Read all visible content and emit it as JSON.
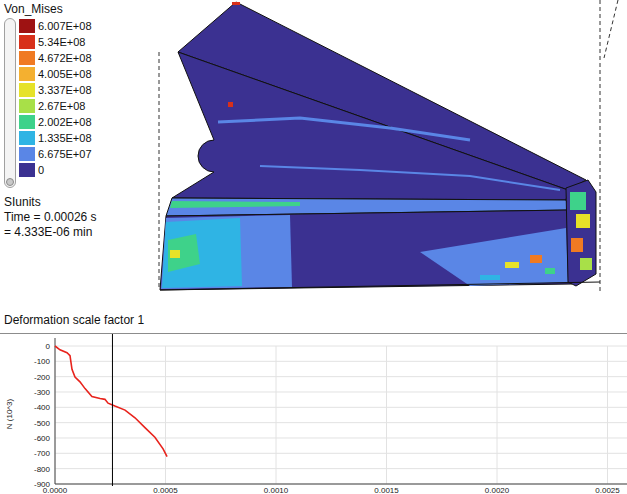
{
  "legend": {
    "title": "Von_Mises",
    "slider": {
      "level": 0
    },
    "levels": [
      {
        "value": "6.007E+08",
        "color": "#9e1212"
      },
      {
        "value": "5.34E+08",
        "color": "#d8301a"
      },
      {
        "value": "4.672E+08",
        "color": "#f07a22"
      },
      {
        "value": "4.005E+08",
        "color": "#f4b030"
      },
      {
        "value": "3.337E+08",
        "color": "#e6e228"
      },
      {
        "value": "2.67E+08",
        "color": "#a8e048"
      },
      {
        "value": "2.002E+08",
        "color": "#3ed28a"
      },
      {
        "value": "1.335E+08",
        "color": "#2fb4e4"
      },
      {
        "value": "6.675E+07",
        "color": "#5a86e6"
      },
      {
        "value": "0",
        "color": "#3b3191"
      }
    ]
  },
  "units": "SIunits",
  "time_lines": [
    "Time = 0.00026 s",
    "= 4.333E-06 min"
  ],
  "deformation": "Deformation scale factor 1",
  "chart": {
    "y_label": "N (10^3)",
    "y_ticks": [
      "0",
      "-100",
      "-200",
      "-300",
      "-400",
      "-500",
      "-600",
      "-700",
      "-800",
      "-900"
    ],
    "x_ticks": [
      "0.0000",
      "0.0005",
      "0.0010",
      "0.0015",
      "0.0020",
      "0.0025"
    ],
    "cursor_x": 0.00026,
    "series": [
      {
        "name": "N",
        "color": "#e8231c",
        "x": [
          0,
          2.26e-05,
          5.43e-05,
          6.79e-05,
          7.69e-05,
          9.05e-05,
          0.000113,
          0.000136,
          0.000167,
          0.000204,
          0.000226,
          0.00024,
          0.000271,
          0.000317,
          0.000362,
          0.000407,
          0.000452,
          0.000489,
          0.000507
        ],
        "y": [
          0,
          -25,
          -44,
          -63,
          -152,
          -203,
          -234,
          -278,
          -329,
          -342,
          -348,
          -373,
          -392,
          -418,
          -468,
          -532,
          -595,
          -671,
          -722
        ]
      }
    ]
  }
}
